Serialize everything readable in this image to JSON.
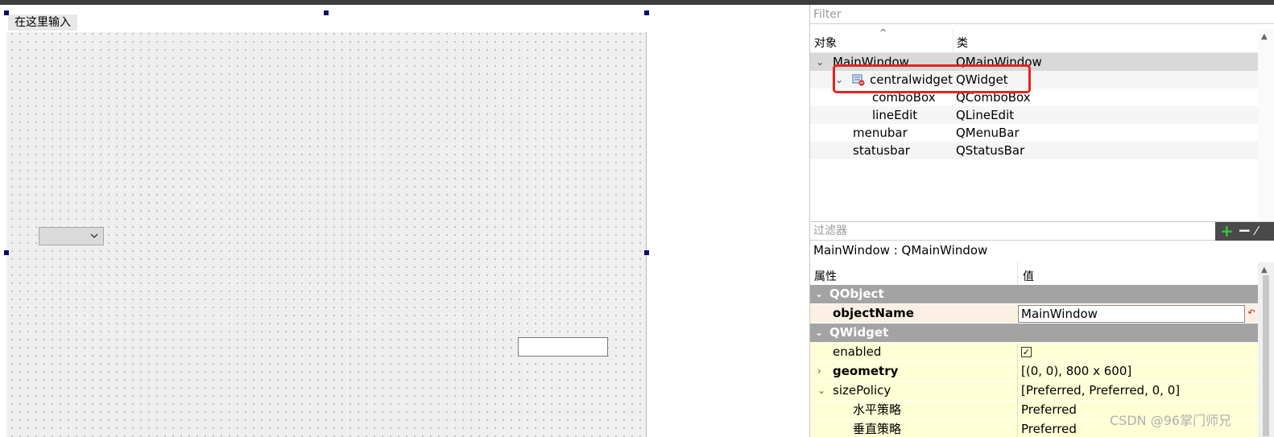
{
  "designer": {
    "menubar": {
      "type_here_label": "在这里输入"
    }
  },
  "object_inspector": {
    "filter_placeholder": "Filter",
    "columns": {
      "object": "对象",
      "class": "类"
    },
    "rows": [
      {
        "name": "MainWindow",
        "class": "QMainWindow"
      },
      {
        "name": "centralwidget",
        "class": "QWidget"
      },
      {
        "name": "comboBox",
        "class": "QComboBox"
      },
      {
        "name": "lineEdit",
        "class": "QLineEdit"
      },
      {
        "name": "menubar",
        "class": "QMenuBar"
      },
      {
        "name": "statusbar",
        "class": "QStatusBar"
      }
    ]
  },
  "property_editor": {
    "filter_placeholder": "过滤器",
    "title": "MainWindow : QMainWindow",
    "columns": {
      "property": "属性",
      "value": "值"
    },
    "groups": {
      "qobject": "QObject",
      "qwidget": "QWidget"
    },
    "props": {
      "objectName": {
        "name": "objectName",
        "value": "MainWindow"
      },
      "enabled": {
        "name": "enabled",
        "value": "✓"
      },
      "geometry": {
        "name": "geometry",
        "value": "[(0, 0), 800 x 600]"
      },
      "sizePolicy": {
        "name": "sizePolicy",
        "value": "[Preferred, Preferred, 0, 0]"
      },
      "hpolicy": {
        "name": "水平策略",
        "value": "Preferred"
      },
      "vpolicy": {
        "name": "垂直策略",
        "value": "Preferred"
      }
    }
  },
  "watermark": "CSDN @96掌门师兄",
  "colors": {
    "highlight_box": "#e8231d",
    "group_row": "#a3a3a3",
    "widget_rows": "#ffffd6",
    "object_rows": "#fcefe3"
  }
}
